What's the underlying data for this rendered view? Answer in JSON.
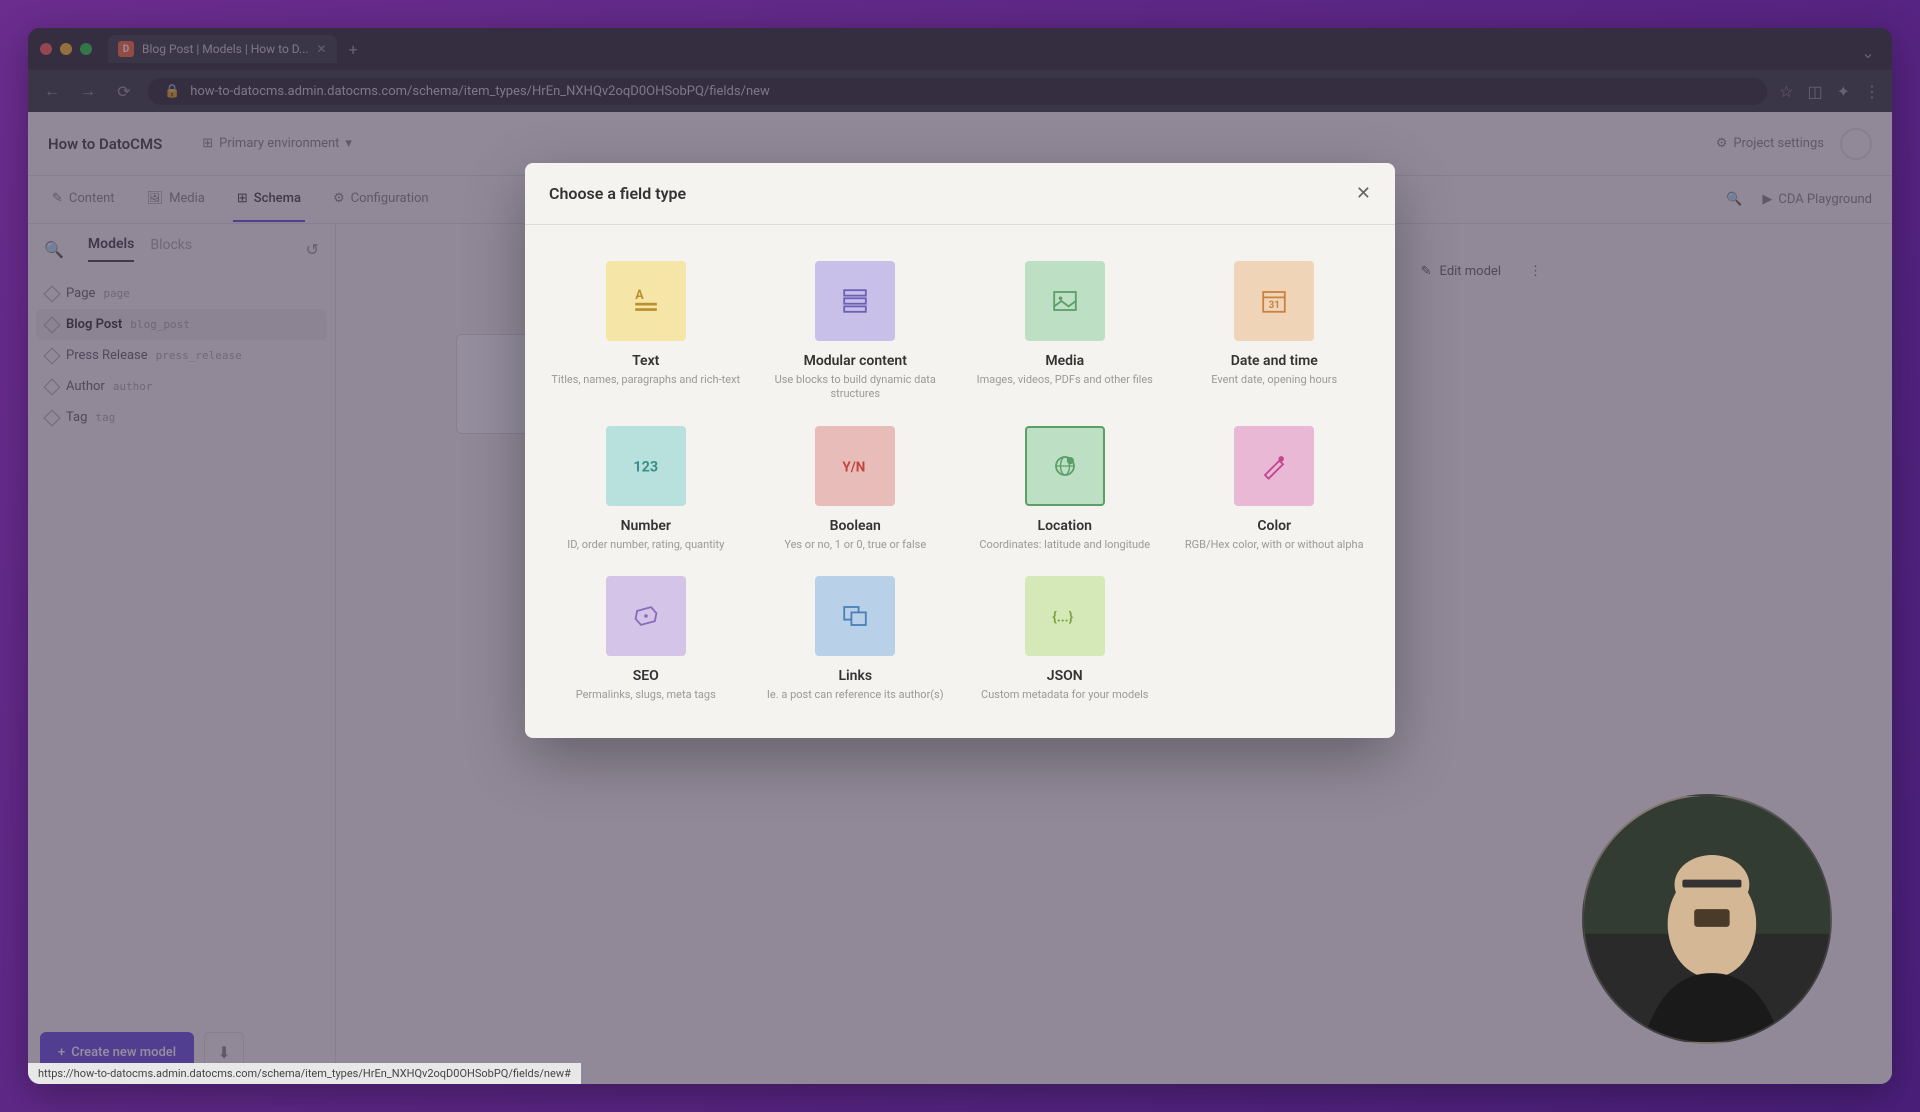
{
  "browser": {
    "tab_title": "Blog Post | Models | How to D...",
    "url": "how-to-datocms.admin.datocms.com/schema/item_types/HrEn_NXHQv2oqD0OHSobPQ/fields/new"
  },
  "app": {
    "title": "How to DatoCMS",
    "environment": "Primary environment",
    "project_settings": "Project settings",
    "tabs": {
      "content": "Content",
      "media": "Media",
      "schema": "Schema",
      "configuration": "Configuration",
      "cda_playground": "CDA Playground"
    }
  },
  "sidebar": {
    "tabs": {
      "models": "Models",
      "blocks": "Blocks"
    },
    "models": [
      {
        "name": "Page",
        "api": "page"
      },
      {
        "name": "Blog Post",
        "api": "blog_post"
      },
      {
        "name": "Press Release",
        "api": "press_release"
      },
      {
        "name": "Author",
        "api": "author"
      },
      {
        "name": "Tag",
        "api": "tag"
      }
    ],
    "create_button": "Create new model"
  },
  "main": {
    "edit_model": "Edit model"
  },
  "modal": {
    "title": "Choose a field type",
    "field_types": [
      {
        "name": "Text",
        "desc": "Titles, names, paragraphs and rich-text"
      },
      {
        "name": "Modular content",
        "desc": "Use blocks to build dynamic data structures"
      },
      {
        "name": "Media",
        "desc": "Images, videos, PDFs and other files"
      },
      {
        "name": "Date and time",
        "desc": "Event date, opening hours"
      },
      {
        "name": "Number",
        "desc": "ID, order number, rating, quantity"
      },
      {
        "name": "Boolean",
        "desc": "Yes or no, 1 or 0, true or false"
      },
      {
        "name": "Location",
        "desc": "Coordinates: latitude and longitude"
      },
      {
        "name": "Color",
        "desc": "RGB/Hex color, with or without alpha"
      },
      {
        "name": "SEO",
        "desc": "Permalinks, slugs, meta tags"
      },
      {
        "name": "Links",
        "desc": "Ie. a post can reference its author(s)"
      },
      {
        "name": "JSON",
        "desc": "Custom metadata for your models"
      }
    ]
  },
  "status_bar": "https://how-to-datocms.admin.datocms.com/schema/item_types/HrEn_NXHQv2oqD0OHSobPQ/fields/new#"
}
